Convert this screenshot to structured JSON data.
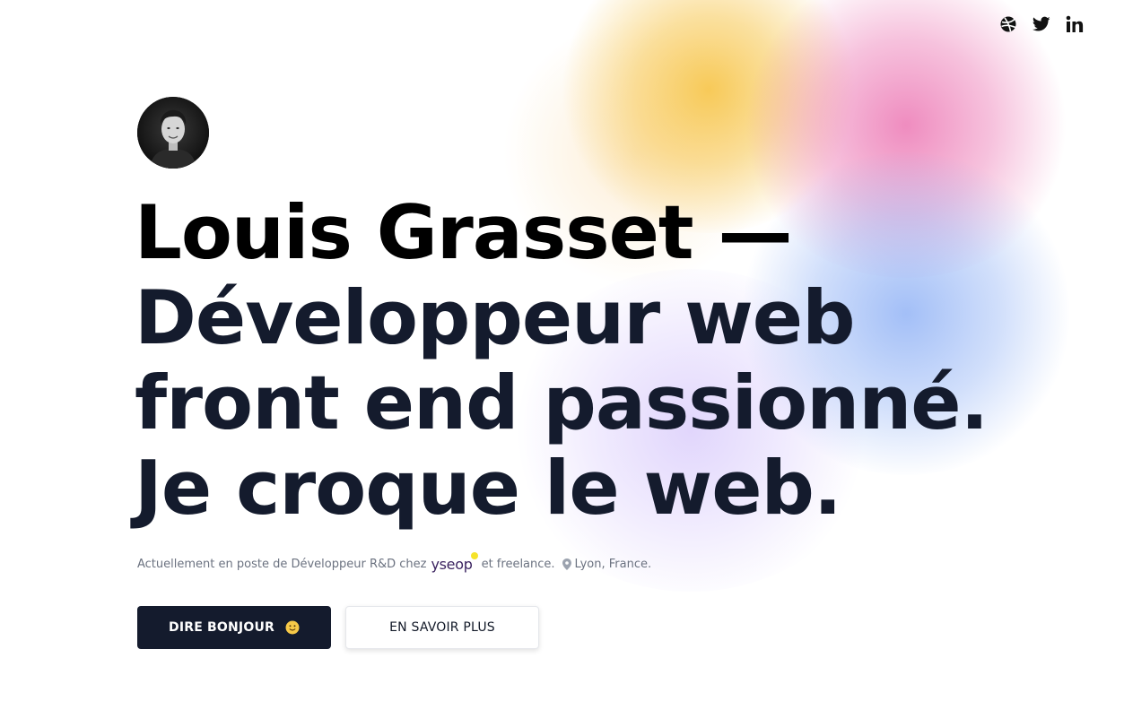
{
  "socials": [
    {
      "icon": "dribbble-icon",
      "label": "Dribbble"
    },
    {
      "icon": "twitter-icon",
      "label": "Twitter"
    },
    {
      "icon": "linkedin-icon",
      "label": "LinkedIn"
    }
  ],
  "hero": {
    "avatar_alt": "Louis Grasset",
    "headline": {
      "line1": "Louis Grasset —",
      "line2": "Développeur web",
      "line3": "front end passionné.",
      "line4": "Je croque le web."
    },
    "subline": {
      "prefix": "Actuellement en poste de Développeur R&D chez",
      "brand": "yseop",
      "suffix": "et freelance.",
      "location": "Lyon, France."
    }
  },
  "actions": {
    "primary_label": "DIRE BONJOUR",
    "primary_emoji": "🙂",
    "secondary_label": "EN SAVOIR PLUS"
  },
  "colors": {
    "text_dark": "#141b2d",
    "button_dark": "#141b2d",
    "muted": "#6b7280",
    "brand_accent": "#f5e32a"
  }
}
